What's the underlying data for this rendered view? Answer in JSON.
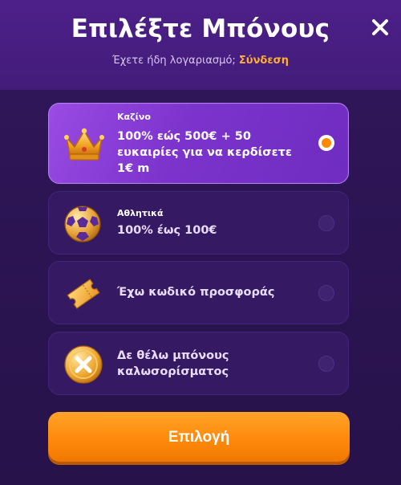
{
  "header": {
    "title": "Επιλέξτε Μπόνους",
    "login_prompt": "Έχετε ήδη λογαριασμό;",
    "login_link": "Σύνδεση"
  },
  "options": [
    {
      "category": "Καζίνο",
      "text": "100% εώς 500€ + 50 ευκαιρίες για να κερδίσετε 1€ m",
      "icon": "crown-icon",
      "selected": true
    },
    {
      "category": "Αθλητικά",
      "text": "100% έως 100€",
      "icon": "soccer-ball-icon",
      "selected": false
    },
    {
      "category": "",
      "text": "Έχω κωδικό προσφοράς",
      "icon": "ticket-icon",
      "selected": false
    },
    {
      "category": "",
      "text": "Δε θέλω μπόνους καλωσορίσματος",
      "icon": "no-bonus-icon",
      "selected": false
    }
  ],
  "cta_label": "Επιλογή",
  "colors": {
    "accent": "#ff8a00",
    "link": "#ffb02e",
    "selected_card": "#8a3fd8",
    "card": "#351a63"
  }
}
